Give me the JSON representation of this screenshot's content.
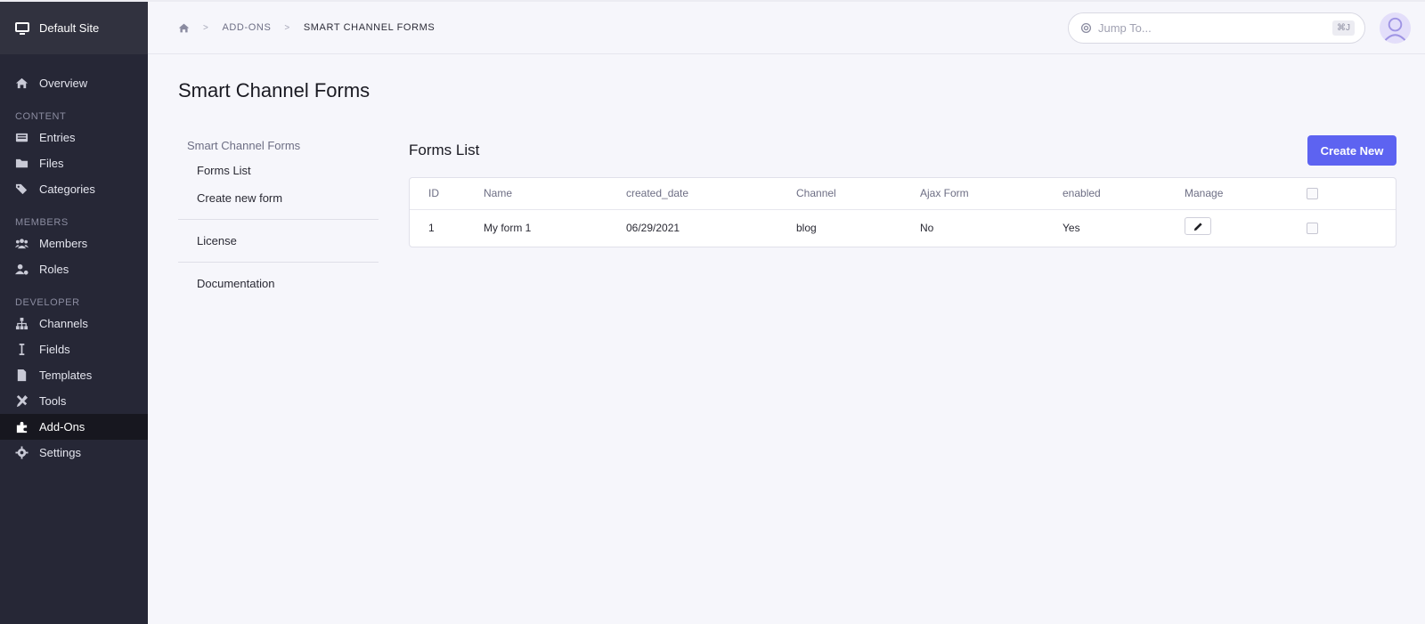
{
  "sidebar": {
    "site_name": "Default Site",
    "overview": "Overview",
    "sections": {
      "content": "CONTENT",
      "members": "MEMBERS",
      "developer": "DEVELOPER"
    },
    "items": {
      "entries": "Entries",
      "files": "Files",
      "categories": "Categories",
      "members": "Members",
      "roles": "Roles",
      "channels": "Channels",
      "fields": "Fields",
      "templates": "Templates",
      "tools": "Tools",
      "addons": "Add-Ons",
      "settings": "Settings"
    },
    "active": "addons"
  },
  "topbar": {
    "breadcrumb": [
      "ADD-ONS",
      "SMART CHANNEL FORMS"
    ],
    "separator": ">",
    "jump_placeholder": "Jump To...",
    "jump_shortcut": "⌘J"
  },
  "page": {
    "title": "Smart Channel Forms"
  },
  "subnav": {
    "heading": "Smart Channel Forms",
    "forms_list": "Forms List",
    "create_new_form": "Create new form",
    "license": "License",
    "documentation": "Documentation"
  },
  "forms": {
    "title": "Forms List",
    "create_button": "Create New",
    "columns": [
      "ID",
      "Name",
      "created_date",
      "Channel",
      "Ajax Form",
      "enabled",
      "Manage"
    ],
    "rows": [
      {
        "id": "1",
        "name": "My form 1",
        "created_date": "06/29/2021",
        "channel": "blog",
        "ajax_form": "No",
        "enabled": "Yes"
      }
    ]
  },
  "colors": {
    "sidebar_bg": "#262736",
    "accent": "#5d63f1",
    "page_bg": "#f6f6fb"
  },
  "icons": {
    "site": "monitor-icon",
    "home": "home-icon",
    "search": "search-icon",
    "edit": "pencil-icon"
  }
}
